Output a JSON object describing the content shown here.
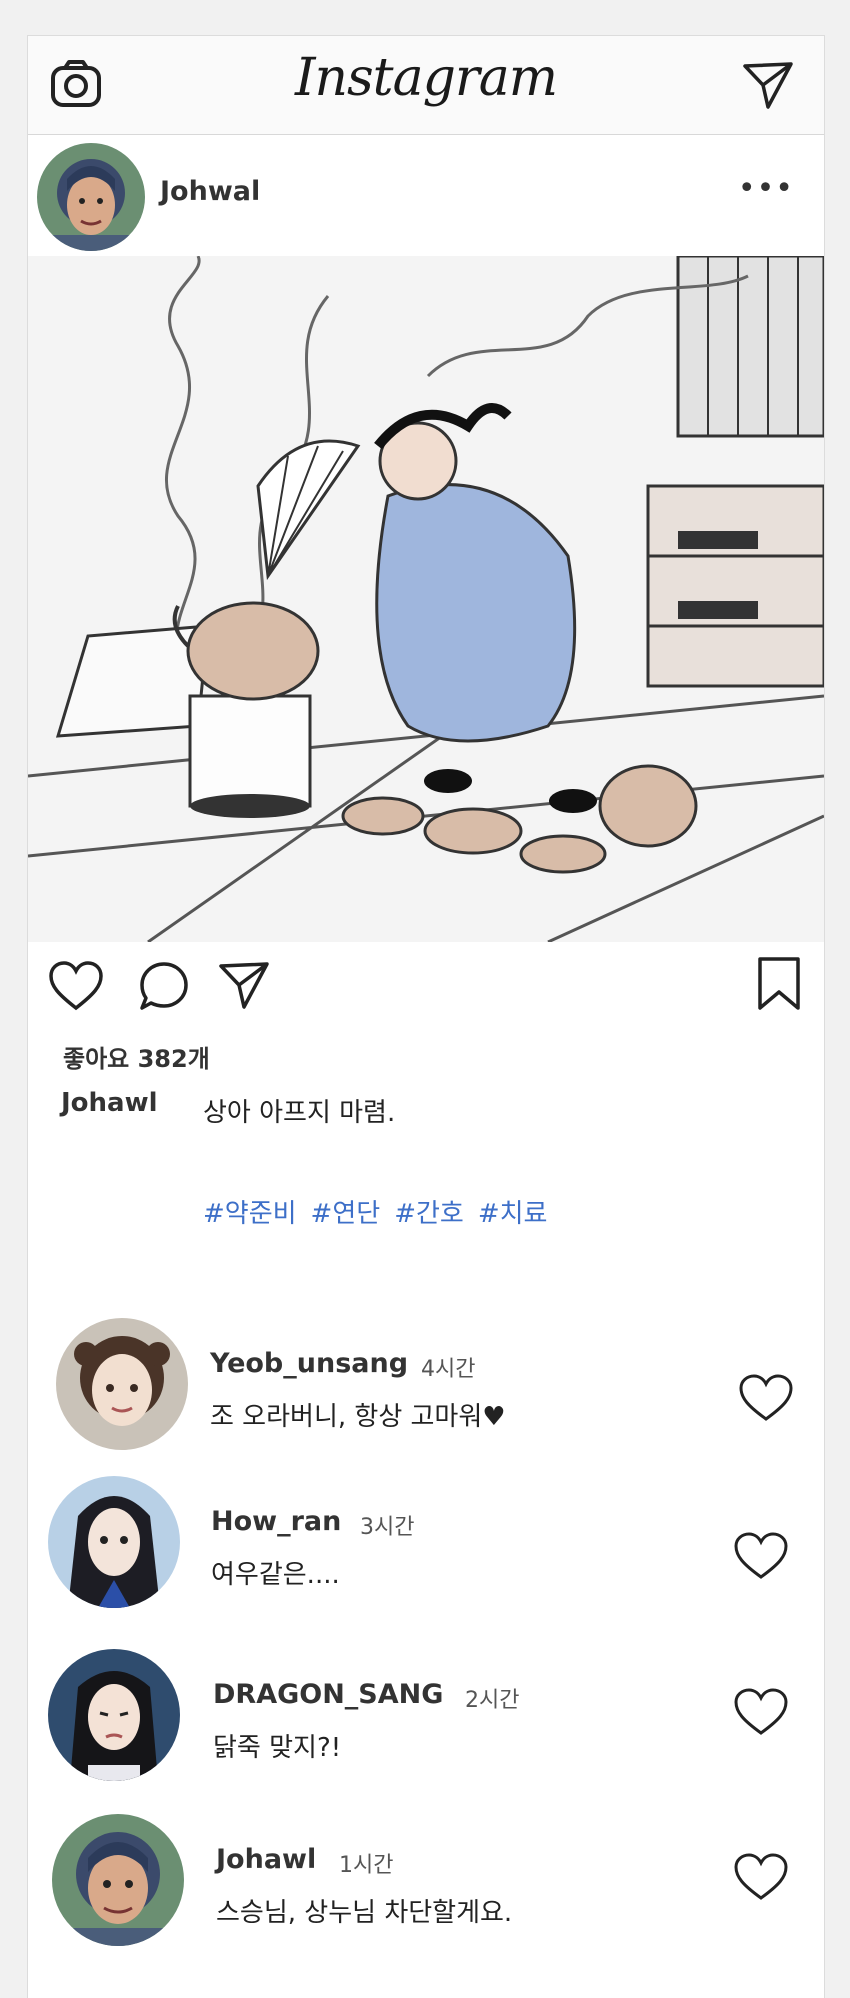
{
  "header": {
    "logo": "Instagram",
    "camera_icon": "camera-icon",
    "direct_icon": "paper-plane-icon"
  },
  "post": {
    "username": "Johwal",
    "more_label": "•••",
    "image_description_icon": "illustration",
    "likes": "좋아요 382개",
    "caption_user": "Johawl",
    "caption_text": "상아 아프지 마렴.",
    "hashtags": [
      "#약준비",
      "#연단",
      "#간호",
      "#치료"
    ]
  },
  "comments": [
    {
      "user": "Yeob_unsang",
      "time": "4시간",
      "text": "조 오라버니, 항상 고마워♥"
    },
    {
      "user": "How_ran",
      "time": "3시간",
      "text": "여우같은...."
    },
    {
      "user": "DRAGON_SANG",
      "time": "2시간",
      "text": "닭죽 맞지?!"
    },
    {
      "user": "Johawl",
      "time": "1시간",
      "text": "스승님, 상누님 차단할게요."
    }
  ],
  "colors": {
    "hashtag": "#3d6fc8",
    "accent_blue": "#7d9fd4"
  }
}
